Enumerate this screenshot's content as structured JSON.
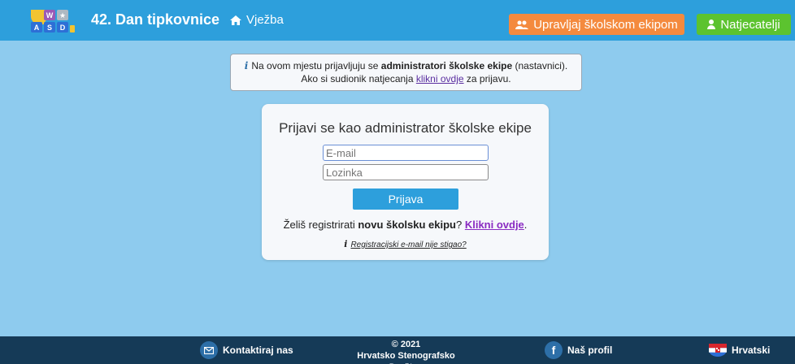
{
  "header": {
    "logo_letters": [
      "W",
      "A",
      "S",
      "D"
    ],
    "title": "42. Dan tipkovnice",
    "nav_vjezba": "Vježba",
    "btn_team": "Upravljaj školskom ekipom",
    "btn_competitors": "Natjecatelji",
    "colors": {
      "bar": "#2d9fdc",
      "team_button": "#f48a3e",
      "competitors_button": "#5cc32f"
    }
  },
  "info": {
    "line1_pre": "Na ovom mjestu prijavljuju se ",
    "line1_bold": "administratori školske ekipe",
    "line1_post": " (nastavnici).",
    "line2_pre": "Ako si sudionik natjecanja ",
    "line2_link": "klikni ovdje",
    "line2_post": " za prijavu."
  },
  "login": {
    "title": "Prijavi se kao administrator školske ekipe",
    "email_placeholder": "E-mail",
    "password_placeholder": "Lozinka",
    "submit": "Prijava",
    "register_pre": "Želiš registrirati ",
    "register_bold": "novu školsku ekipu",
    "register_q": "? ",
    "register_link": "Klikni ovdje",
    "register_end": ".",
    "resend_link": "Registracijski e-mail nije stigao?"
  },
  "footer": {
    "contact": "Kontaktiraj nas",
    "copyright_line1": "© 2021",
    "copyright_line2": "Hrvatsko Stenografsko Društvo",
    "profile": "Naš profil",
    "language": "Hrvatski"
  }
}
